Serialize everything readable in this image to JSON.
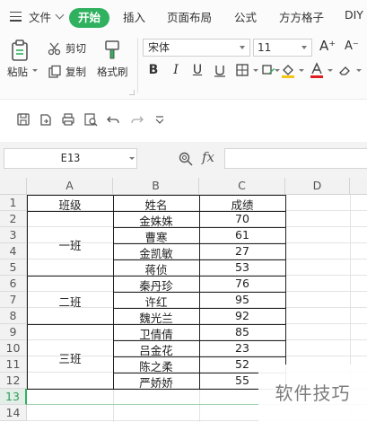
{
  "menu": {
    "file": "文件",
    "start": "开始",
    "insert": "插入",
    "page_layout": "页面布局",
    "formula": "公式",
    "fangfang": "方方格子",
    "diy": "DIY"
  },
  "ribbon": {
    "cut": "剪切",
    "paste": "粘贴",
    "copy": "复制",
    "format_painter": "格式刷",
    "font_name": "宋体",
    "font_size": "11",
    "bold": "B",
    "italic": "I",
    "underline": "U",
    "grow_font": "A⁺",
    "shrink_font": "A⁻"
  },
  "formula_bar": {
    "cell_ref": "E13",
    "fx_label": "fx",
    "formula_value": ""
  },
  "columns": [
    "A",
    "B",
    "C",
    "D"
  ],
  "rows": [
    "1",
    "2",
    "3",
    "4",
    "5",
    "6",
    "7",
    "8",
    "9",
    "10",
    "11",
    "12",
    "13",
    "14"
  ],
  "table": {
    "headers": [
      "班级",
      "姓名",
      "成绩"
    ],
    "classes": [
      "一班",
      "二班",
      "三班"
    ],
    "names": [
      "金姝姝",
      "曹寒",
      "金凯敏",
      "蒋侦",
      "秦丹珍",
      "许红",
      "魏光兰",
      "卫倩倩",
      "吕金花",
      "陈之柔",
      "严娇娇"
    ],
    "scores": [
      "70",
      "61",
      "27",
      "53",
      "76",
      "95",
      "92",
      "85",
      "23",
      "52",
      "55"
    ]
  },
  "watermark": "软件技巧",
  "colors": {
    "accent": "#2fb15f",
    "font_color_underline": "#e02020",
    "fill_color_underline": "#f5c518"
  }
}
